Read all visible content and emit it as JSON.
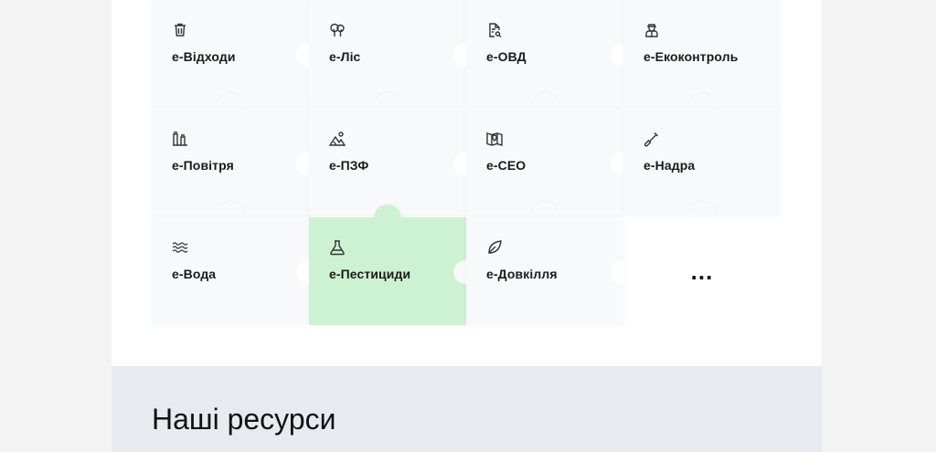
{
  "tiles": [
    {
      "label": "е-Відходи",
      "icon": "trash-icon"
    },
    {
      "label": "е-Ліс",
      "icon": "trees-icon"
    },
    {
      "label": "е-ОВД",
      "icon": "document-search-icon"
    },
    {
      "label": "е-Екоконтроль",
      "icon": "inspector-icon"
    },
    {
      "label": "е-Повітря",
      "icon": "factory-chimneys-icon"
    },
    {
      "label": "е-ПЗФ",
      "icon": "mountain-icon"
    },
    {
      "label": "е-СЕО",
      "icon": "map-location-icon"
    },
    {
      "label": "е-Надра",
      "icon": "shovel-icon"
    },
    {
      "label": "е-Вода",
      "icon": "waves-icon"
    },
    {
      "label": "е-Пестициди",
      "icon": "flask-icon",
      "active": true
    },
    {
      "label": "е-Довкілля",
      "icon": "leaf-icon"
    }
  ],
  "more_label": "...",
  "resources": {
    "title": "Наші ресурси"
  },
  "colors": {
    "tile_bg": "#f8f9fa",
    "active_bg": "#cdf2d1",
    "page_bg": "#f3f3f3",
    "resources_bg": "#e7ebef"
  }
}
